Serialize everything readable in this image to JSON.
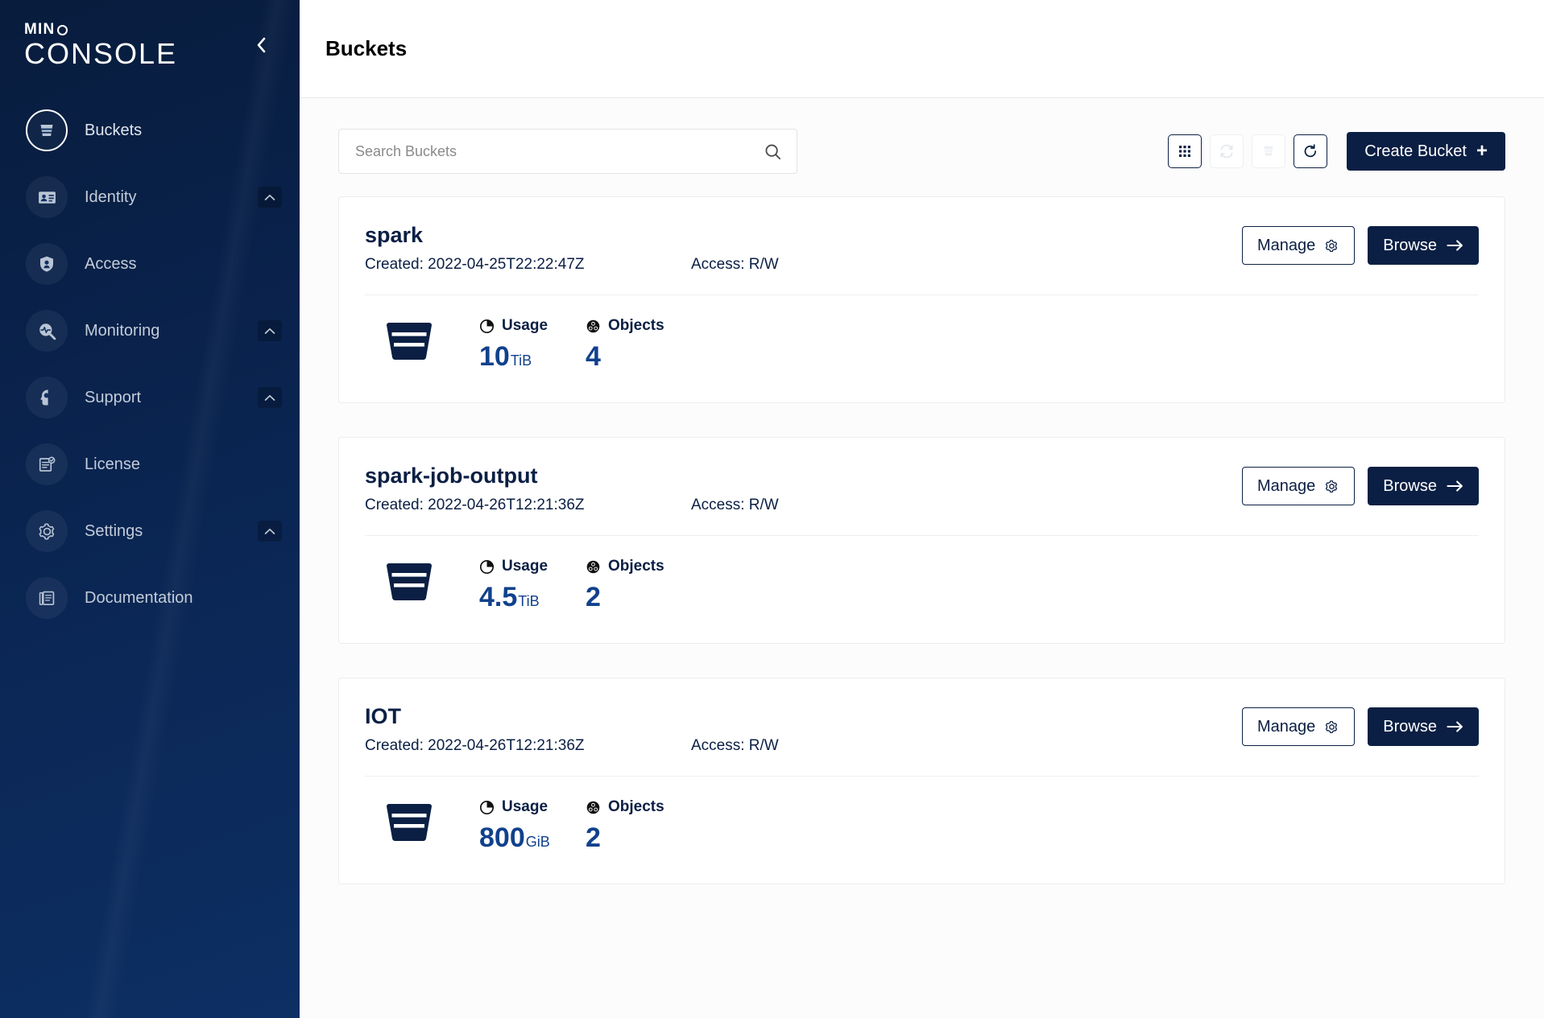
{
  "brand": {
    "mini": "MIN",
    "mini_o": "O",
    "console": "CONSOLE",
    "collapse_icon": "chevron-left-icon"
  },
  "sidebar": {
    "items": [
      {
        "label": "Buckets",
        "icon": "bucket-icon",
        "active": true,
        "caret": false
      },
      {
        "label": "Identity",
        "icon": "id-card-icon",
        "active": false,
        "caret": true
      },
      {
        "label": "Access",
        "icon": "shield-lock-icon",
        "active": false,
        "caret": false
      },
      {
        "label": "Monitoring",
        "icon": "magnifier-pulse-icon",
        "active": false,
        "caret": true
      },
      {
        "label": "Support",
        "icon": "head-support-icon",
        "active": false,
        "caret": true
      },
      {
        "label": "License",
        "icon": "license-document-icon",
        "active": false,
        "caret": false
      },
      {
        "label": "Settings",
        "icon": "gear-icon",
        "active": false,
        "caret": true
      },
      {
        "label": "Documentation",
        "icon": "book-pages-icon",
        "active": false,
        "caret": false
      }
    ]
  },
  "header": {
    "title": "Buckets"
  },
  "toolbar": {
    "search_placeholder": "Search Buckets",
    "search_value": "",
    "search_icon": "search-icon",
    "buttons": [
      {
        "name": "grid-view-toggle",
        "icon": "grid-icon",
        "disabled": false
      },
      {
        "name": "replicate-button",
        "icon": "sync-icon",
        "disabled": true
      },
      {
        "name": "delete-buckets-button",
        "icon": "stack-icon",
        "disabled": true
      },
      {
        "name": "refresh-button",
        "icon": "refresh-icon",
        "disabled": false
      }
    ],
    "create_label": "Create Bucket",
    "create_plus": "+"
  },
  "labels": {
    "created_prefix": "Created: ",
    "access_prefix": "Access: ",
    "usage": "Usage",
    "objects": "Objects",
    "manage": "Manage",
    "browse": "Browse",
    "manage_icon": "gear-icon",
    "browse_icon": "arrow-right-icon",
    "usage_icon": "pie-chart-icon",
    "objects_icon": "objects-trefoil-icon",
    "bucket_icon": "bucket-icon"
  },
  "buckets": [
    {
      "name": "spark",
      "created": "2022-04-25T22:22:47Z",
      "created_full": "Created: 2022-04-25T22:22:47Z",
      "access": "R/W",
      "access_full": "Access: R/W",
      "usage_value": "10",
      "usage_unit": "TiB",
      "objects": "4"
    },
    {
      "name": "spark-job-output",
      "created": "2022-04-26T12:21:36Z",
      "created_full": "Created: 2022-04-26T12:21:36Z",
      "access": "R/W",
      "access_full": "Access: R/W",
      "usage_value": "4.5",
      "usage_unit": "TiB",
      "objects": "2"
    },
    {
      "name": "IOT",
      "created": "2022-04-26T12:21:36Z",
      "created_full": "Created: 2022-04-26T12:21:36Z",
      "access": "R/W",
      "access_full": "Access: R/W",
      "usage_value": "800",
      "usage_unit": "GiB",
      "objects": "2"
    }
  ],
  "colors": {
    "sidebar_top": "#081c3d",
    "sidebar_bottom": "#0d2f63",
    "navy": "#0b1f44",
    "accent_blue": "#11418c",
    "page_bg": "#fcfcfc"
  }
}
